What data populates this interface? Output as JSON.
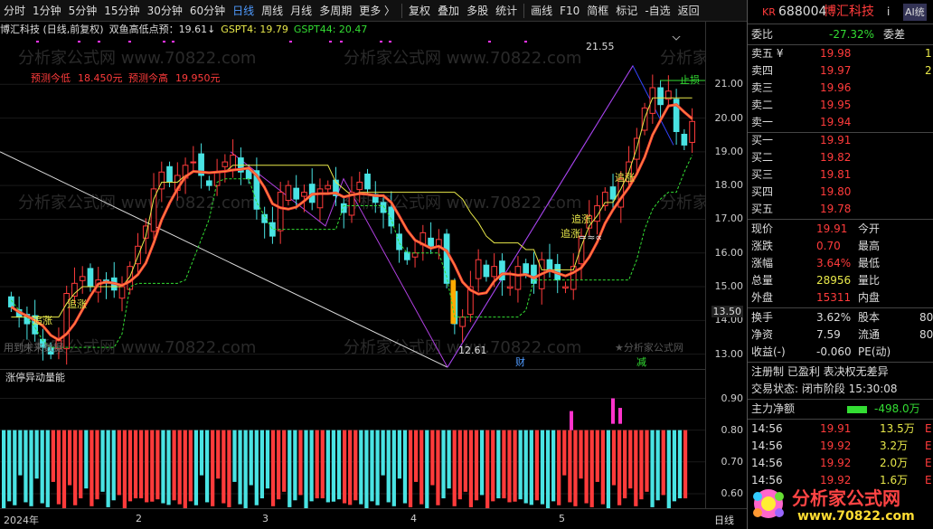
{
  "toolbar": {
    "items": [
      "分时",
      "1分钟",
      "5分钟",
      "15分钟",
      "30分钟",
      "60分钟",
      "日线",
      "周线",
      "月线",
      "多周期",
      "更多 〉",
      "复权",
      "叠加",
      "多股",
      "统计",
      "画线",
      "F10",
      "简框",
      "标记",
      "-自选",
      "返回"
    ],
    "active_index": 6
  },
  "header": {
    "stock": "博汇科技 (日线,前复权)",
    "indicator": "双鱼高低点预：19.61↓",
    "gspt4": "GSPT4: 19.79",
    "gspt44": "GSPT44: 20.47"
  },
  "chart": {
    "forecast_low_label": "预测今低",
    "forecast_low_value": "18.450元",
    "forecast_high_label": "预测今高",
    "forecast_high_value": "19.950元",
    "high_label": "21.55",
    "low_label": "12.61",
    "future_data": "用到未来数据",
    "watermark": "分析家公式网 www.70822.com",
    "watermark_small": "★分析家公式网",
    "zhui_zhang": "追涨",
    "jian": "减",
    "cai": "财",
    "zhisun": "止损",
    "price_marker": "13.50",
    "eq_label": "=≈∝",
    "colors": {
      "up": "#ff3b3b",
      "down": "#49e3e3",
      "ma": "#ff3b3b",
      "yellow": "#e8e84a",
      "green": "#33dd33",
      "purple": "#b040e0",
      "blue": "#3344ff",
      "white": "#dddddd"
    },
    "price_axis": [
      "21.00",
      "20.00",
      "19.00",
      "18.00",
      "17.00",
      "16.00",
      "15.00",
      "14.00",
      "13.00"
    ],
    "vol_axis": [
      "0.90",
      "0.80",
      "0.70",
      "0.60"
    ]
  },
  "sub": {
    "title": "涨停异动量能"
  },
  "dates": [
    "2024年",
    "2",
    "3",
    "4",
    "5"
  ],
  "datebar_right": "日线",
  "panel": {
    "code_prefix": "KR",
    "code": "688004",
    "name": "博汇科技",
    "info": "i",
    "ai": "AI统",
    "weibi_label": "委比",
    "weibi": "-27.32%",
    "weicha_label": "委差",
    "asks": [
      {
        "label": "卖五 ¥",
        "price": "19.98",
        "vol": "1"
      },
      {
        "label": "卖四",
        "price": "19.97",
        "vol": "2"
      },
      {
        "label": "卖三",
        "price": "19.96",
        "vol": ""
      },
      {
        "label": "卖二",
        "price": "19.95",
        "vol": ""
      },
      {
        "label": "卖一",
        "price": "19.94",
        "vol": ""
      }
    ],
    "bids": [
      {
        "label": "买一",
        "price": "19.91"
      },
      {
        "label": "买二",
        "price": "19.82"
      },
      {
        "label": "买三",
        "price": "19.81"
      },
      {
        "label": "买四",
        "price": "19.80"
      },
      {
        "label": "买五",
        "price": "19.78"
      }
    ],
    "stats": [
      {
        "l": "现价",
        "v": "19.91",
        "c": "red",
        "r": "今开"
      },
      {
        "l": "涨跌",
        "v": "0.70",
        "c": "red",
        "r": "最高"
      },
      {
        "l": "涨幅",
        "v": "3.64%",
        "c": "red",
        "r": "最低"
      },
      {
        "l": "总量",
        "v": "28956",
        "c": "yellow",
        "r": "量比"
      },
      {
        "l": "外盘",
        "v": "15311",
        "c": "red",
        "r": "内盘"
      }
    ],
    "stats2": [
      {
        "l": "换手",
        "v": "3.62%",
        "r": "股本",
        "rv": "80"
      },
      {
        "l": "净资",
        "v": "7.59",
        "r": "流通",
        "rv": "80"
      },
      {
        "l": "收益(-)",
        "v": "-0.060",
        "r": "PE(动)",
        "rv": ""
      }
    ],
    "flags": "注册制 已盈利 表决权无差异",
    "status": "交易状态: 闭市阶段 15:30:08",
    "netflow_label": "主力净额",
    "netflow": "-498.0万",
    "ticks": [
      {
        "t": "14:56",
        "p": "19.91",
        "v": "13.5万",
        "f": "E"
      },
      {
        "t": "14:56",
        "p": "19.92",
        "v": "3.2万",
        "f": "E"
      },
      {
        "t": "14:56",
        "p": "19.92",
        "v": "2.0万",
        "f": "E"
      },
      {
        "t": "14:56",
        "p": "19.92",
        "v": "1.6万",
        "f": "E"
      }
    ],
    "logo_text": "分析家公式网",
    "logo_url": "www.70822.com"
  },
  "chart_data": {
    "type": "candlestick",
    "y_range": [
      12.4,
      22.0
    ],
    "close_seed": [
      14.4,
      14.1,
      13.9,
      13.6,
      13.2,
      13.0,
      13.4,
      14.8,
      15.1,
      15.3,
      15.0,
      15.2,
      15.1,
      14.9,
      15.0,
      15.6,
      16.2,
      16.8,
      17.9,
      18.4,
      18.1,
      18.3,
      18.6,
      18.7,
      18.3,
      18.0,
      18.4,
      18.7,
      18.9,
      18.4,
      18.2,
      17.3,
      16.9,
      16.5,
      17.8,
      18.0,
      17.6,
      17.8,
      17.5,
      17.9,
      18.0,
      17.7,
      17.2,
      17.8,
      18.1,
      17.9,
      17.5,
      17.2,
      16.8,
      16.1,
      15.8,
      16.0,
      16.6,
      16.2,
      16.4,
      15.1,
      13.9,
      14.1,
      15.0,
      15.8,
      15.3,
      15.6,
      15.2,
      15.0,
      15.6,
      15.4,
      15.1,
      15.8,
      15.5,
      15.2,
      15.0,
      15.6,
      16.5,
      17.1,
      17.4,
      17.8,
      17.6,
      18.2,
      18.7,
      19.4,
      20.3,
      20.9,
      20.4,
      20.8,
      19.6,
      19.2,
      19.9
    ]
  }
}
